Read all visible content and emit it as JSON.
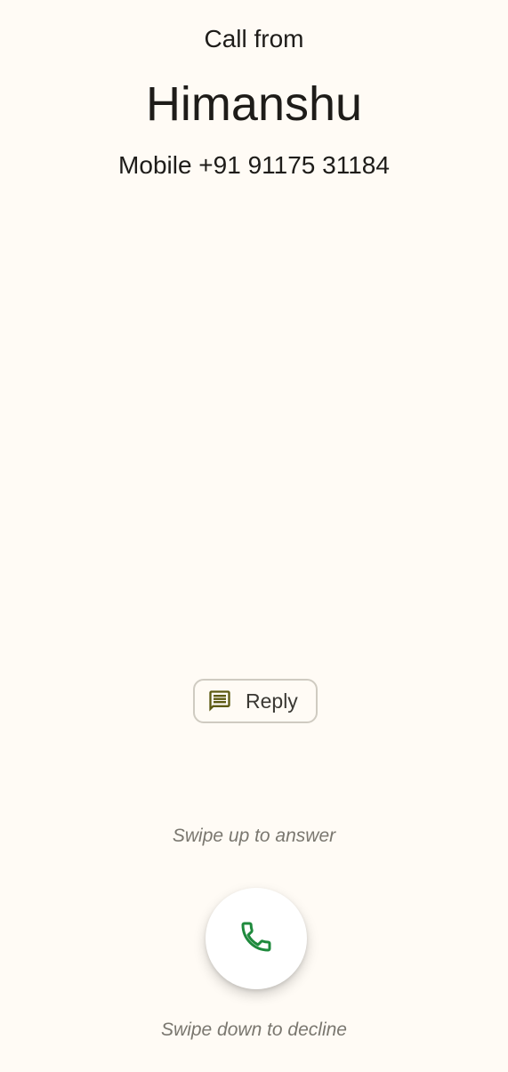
{
  "incoming_call": {
    "header": "Call from",
    "caller_name": "Himanshu",
    "caller_number": "Mobile +91 91175 31184"
  },
  "reply": {
    "label": "Reply",
    "icon": "message-icon"
  },
  "hints": {
    "swipe_up": "Swipe up to answer",
    "swipe_down": "Swipe down to decline"
  },
  "answer": {
    "icon": "phone-icon"
  },
  "colors": {
    "background": "#fffbf5",
    "text": "#1e1c19",
    "hint_text": "#7a776f",
    "reply_icon": "#5c5a12",
    "answer_icon": "#1f8a3d",
    "reply_border": "#cfcbc1"
  }
}
